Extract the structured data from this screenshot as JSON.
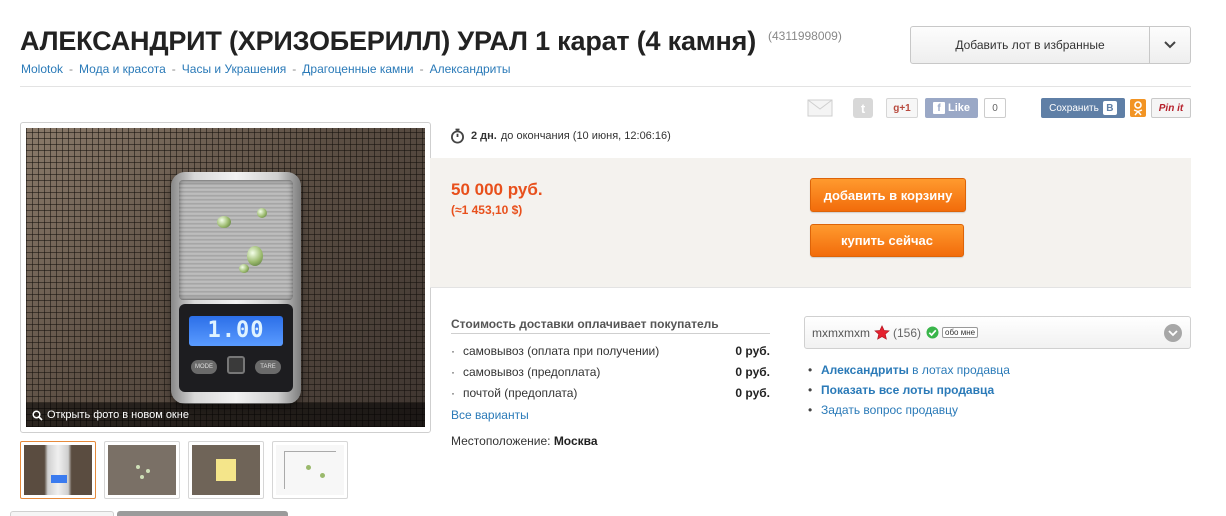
{
  "listing": {
    "title": "АЛЕКСАНДРИТ (ХРИЗОБЕРИЛЛ) УРАЛ 1 карат (4 камня)",
    "lot_id": "(4311998009)"
  },
  "favorites": {
    "add_label": "Добавить лот в избранные"
  },
  "breadcrumb": [
    "Molotok",
    "Мода и красота",
    "Часы и Украшения",
    "Драгоценные камни",
    "Александриты"
  ],
  "breadcrumb_sep": "-",
  "share": {
    "gplus_label": "+1",
    "like_label": "Like",
    "like_count": "0",
    "save_label": "Сохранить",
    "pinit_label": "Pin it"
  },
  "photo": {
    "open_label": "Открыть фото в новом окне",
    "scale_display": "1.00",
    "scale_mode": "MODE",
    "scale_tare": "TARE"
  },
  "timer": {
    "days": "2 дн.",
    "text": "до окончания (10 июня, 12:06:16)"
  },
  "price": {
    "rub": "50 000 руб.",
    "usd": "(≈1 453,10 $)"
  },
  "actions": {
    "add_to_cart": "добавить в корзину",
    "buy_now": "купить сейчас"
  },
  "shipping": {
    "title": "Стоимость доставки оплачивает покупатель",
    "bullet": "·",
    "rows": [
      {
        "label": "самовывоз (оплата при получении)",
        "price": "0 руб."
      },
      {
        "label": "самовывоз (предоплата)",
        "price": "0 руб."
      },
      {
        "label": "почтой (предоплата)",
        "price": "0 руб."
      }
    ],
    "all_variants": "Все варианты",
    "location_label": "Местоположение:",
    "location_value": "Москва"
  },
  "seller": {
    "name": "mxmxmxm",
    "rating": "(156)",
    "about": "обо мне",
    "links_bullet": "•",
    "link1_bold": "Александриты",
    "link1_rest": " в лотах продавца",
    "link2": "Показать все лоты продавца",
    "link3": "Задать вопрос продавцу"
  },
  "colors": {
    "accent_orange": "#f26c0b",
    "price_red": "#e8501c",
    "link_blue": "#2a7ab8",
    "price_box_bg": "#f4f2ee"
  }
}
